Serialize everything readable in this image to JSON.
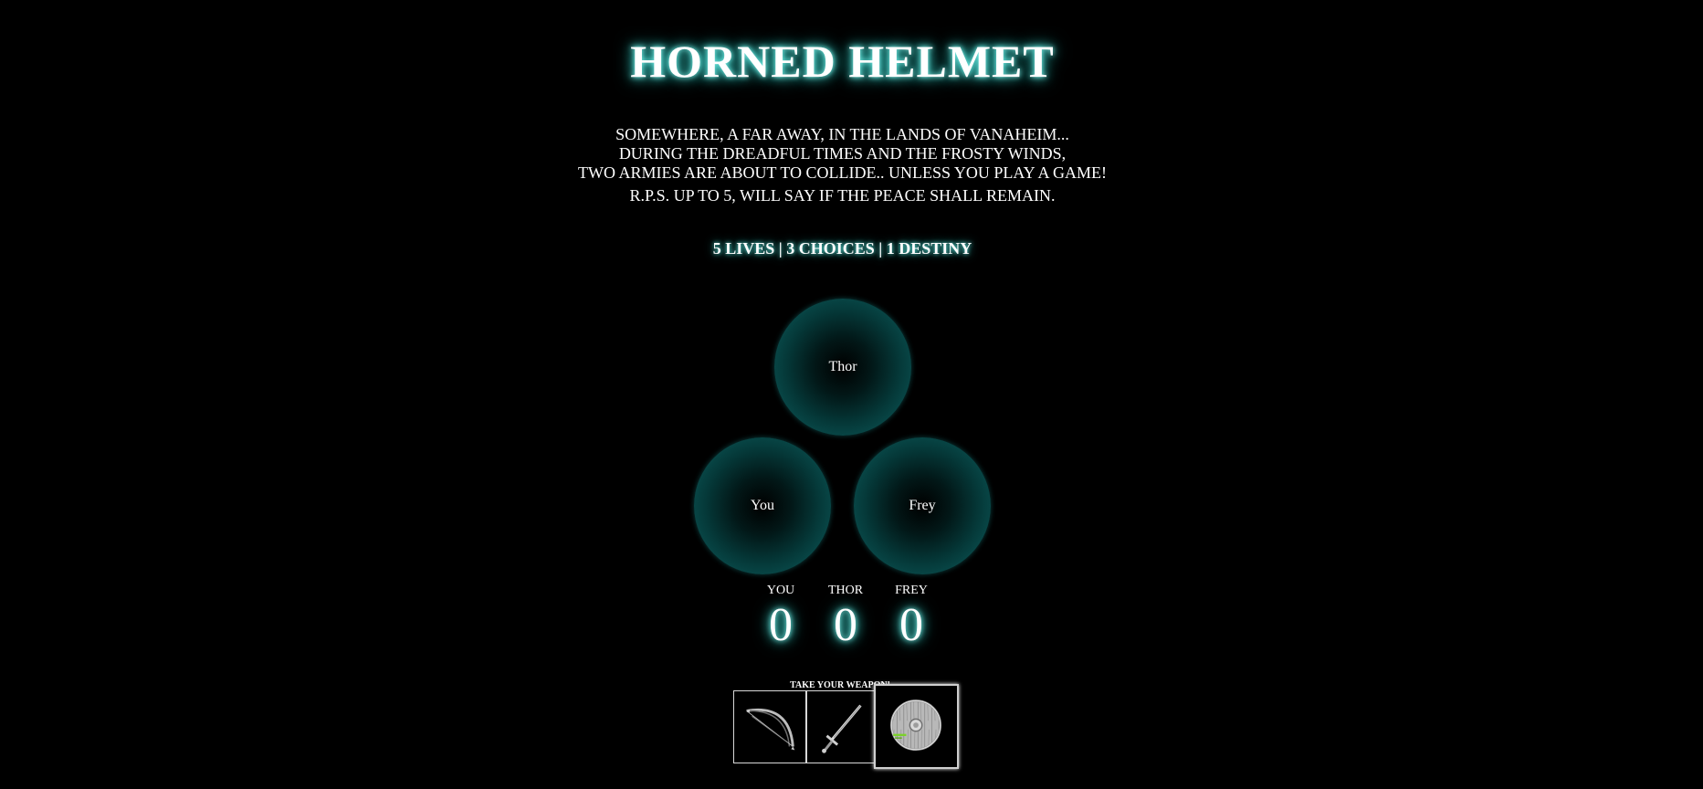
{
  "header": {
    "title": "HORNED HELMET"
  },
  "intro": {
    "line1": "SOMEWHERE, A FAR AWAY, IN THE LANDS OF VANAHEIM...",
    "line2": "DURING THE DREADFUL TIMES AND THE FROSTY WINDS,",
    "line3": "TWO ARMIES ARE ABOUT TO COLLIDE.. UNLESS YOU PLAY A GAME!",
    "line4": "R.P.S. UP TO 5, WILL SAY IF THE PEACE SHALL REMAIN."
  },
  "tagline": "5 LIVES | 3 CHOICES | 1 DESTINY",
  "players": {
    "top": "Thor",
    "left": "You",
    "right": "Frey"
  },
  "scoreboard": {
    "you_label": "YOU",
    "thor_label": "THOR",
    "frey_label": "FREY",
    "you_score": "0",
    "thor_score": "0",
    "frey_score": "0"
  },
  "weapons": {
    "prompt": "TAKE YOUR WEAPON!",
    "items": [
      {
        "name": "bow",
        "icon": "bow-icon"
      },
      {
        "name": "sword",
        "icon": "sword-icon"
      },
      {
        "name": "shield",
        "icon": "shield-icon",
        "selected": true
      }
    ]
  },
  "colors": {
    "background": "#000000",
    "glow": "#3fd8d0",
    "circle": "#0d5555",
    "text": "#ffffff"
  }
}
